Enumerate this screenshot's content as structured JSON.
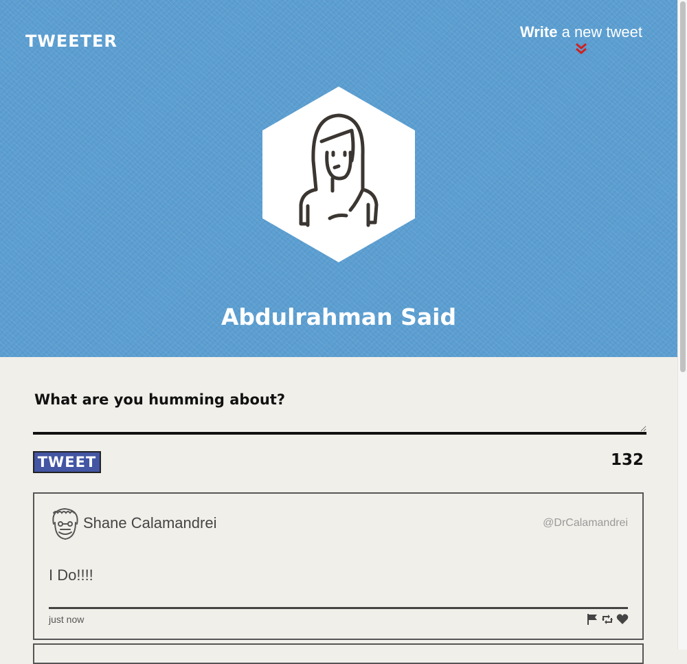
{
  "header": {
    "brand": "TWEETER",
    "compose_toggle": {
      "bold": "Write",
      "rest": " a new tweet"
    }
  },
  "profile": {
    "name": "Abdulrahman Said"
  },
  "composer": {
    "label": "What are you humming about?",
    "placeholder": "",
    "button_label": "TWEET",
    "char_counter": "132"
  },
  "tweets": [
    {
      "author": "Shane Calamandrei",
      "handle": "@DrCalamandrei",
      "text": "I Do!!!!",
      "time": "just now",
      "actions": [
        "flag-icon",
        "retweet-icon",
        "heart-icon"
      ]
    }
  ],
  "colors": {
    "hero_bg": "#5b9ed1",
    "page_bg": "#f1efe9",
    "tweet_button": "#4355a3",
    "chevron": "#d0201f"
  }
}
